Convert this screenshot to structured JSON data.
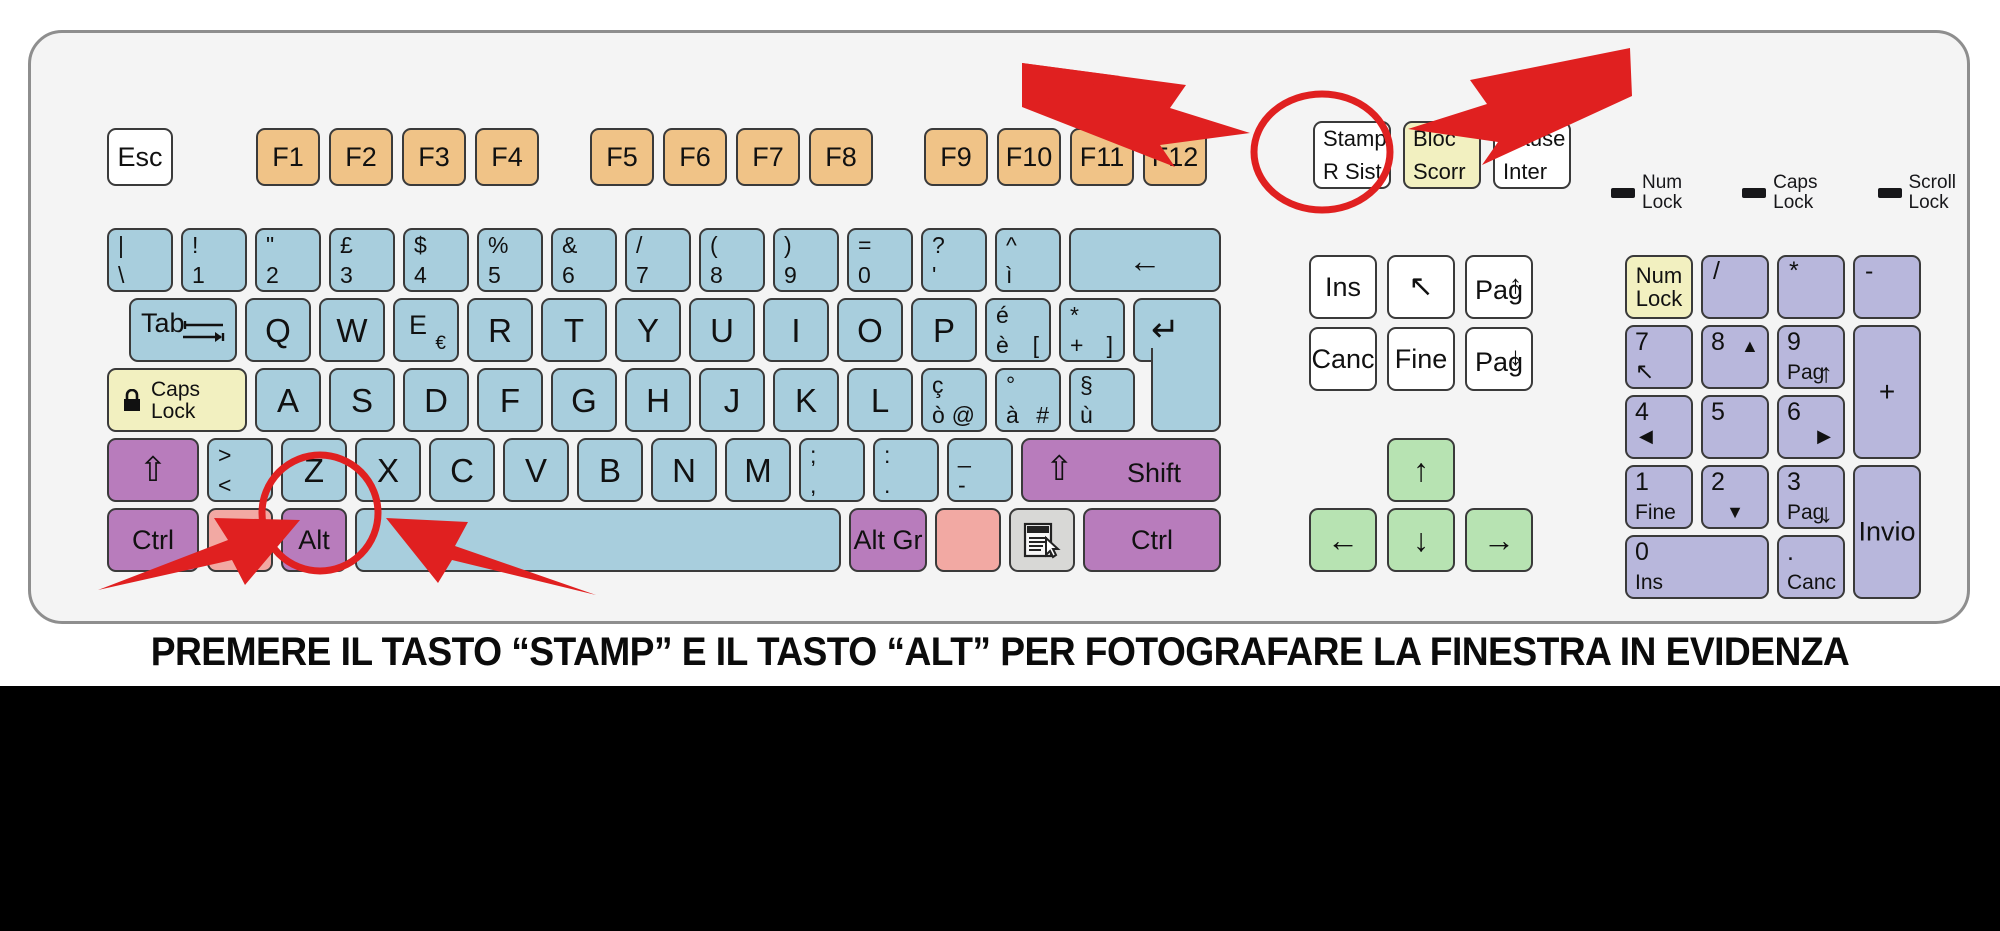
{
  "caption": "PREMERE IL TASTO “STAMP” E IL TASTO “ALT” PER FOTOGRAFARE LA FINESTRA IN EVIDENZA",
  "layout_name": "Italian QWERTY keyboard",
  "colors": {
    "alpha_key": "#a8cedd",
    "function_key": "#f0c387",
    "modifier_key": "#b87cbc",
    "numpad_key": "#b8b7dc",
    "lock_key": "#f2f0c0",
    "arrow_key": "#b7e3b2",
    "win_key": "#f2a9a3",
    "menu_key": "#d8d8d6",
    "highlight": "#e02020",
    "board": "#f4f4f4"
  },
  "escape": {
    "label": "Esc"
  },
  "function_keys": [
    {
      "label": "F1"
    },
    {
      "label": "F2"
    },
    {
      "label": "F3"
    },
    {
      "label": "F4"
    },
    {
      "label": "F5"
    },
    {
      "label": "F6"
    },
    {
      "label": "F7"
    },
    {
      "label": "F8"
    },
    {
      "label": "F9"
    },
    {
      "label": "F10"
    },
    {
      "label": "F11"
    },
    {
      "label": "F12"
    }
  ],
  "system_keys": [
    {
      "top": "Stamp",
      "bottom": "R Sist"
    },
    {
      "top": "Bloc",
      "bottom": "Scorr"
    },
    {
      "top": "Pause",
      "bottom": "Inter"
    }
  ],
  "leds": [
    {
      "line1": "Num",
      "line2": "Lock"
    },
    {
      "line1": "Caps",
      "line2": "Lock"
    },
    {
      "line1": "Scroll",
      "line2": "Lock"
    }
  ],
  "number_row": [
    {
      "top": "|",
      "bottom": "\\"
    },
    {
      "top": "!",
      "bottom": "1"
    },
    {
      "top": "\"",
      "bottom": "2"
    },
    {
      "top": "£",
      "bottom": "3"
    },
    {
      "top": "$",
      "bottom": "4"
    },
    {
      "top": "%",
      "bottom": "5"
    },
    {
      "top": "&",
      "bottom": "6"
    },
    {
      "top": "/",
      "bottom": "7"
    },
    {
      "top": "(",
      "bottom": "8"
    },
    {
      "top": ")",
      "bottom": "9"
    },
    {
      "top": "=",
      "bottom": "0"
    },
    {
      "top": "?",
      "bottom": "'"
    },
    {
      "top": "^",
      "bottom": "ì"
    }
  ],
  "backspace": {
    "glyph": "←"
  },
  "tab": {
    "label": "Tab"
  },
  "qwerty_row": [
    {
      "label": "Q"
    },
    {
      "label": "W"
    },
    {
      "label": "E",
      "sub": "€"
    },
    {
      "label": "R"
    },
    {
      "label": "T"
    },
    {
      "label": "Y"
    },
    {
      "label": "U"
    },
    {
      "label": "I"
    },
    {
      "label": "O"
    },
    {
      "label": "P"
    }
  ],
  "qwerty_extra": [
    {
      "top": "é",
      "bottom": "è",
      "alt": "["
    },
    {
      "top": "*",
      "bottom": "+",
      "alt": "]"
    }
  ],
  "enter": {
    "glyph": "↵"
  },
  "caps_lock": {
    "line1": "Caps",
    "line2": "Lock",
    "icon": "lock-icon"
  },
  "home_row": [
    {
      "label": "A"
    },
    {
      "label": "S"
    },
    {
      "label": "D"
    },
    {
      "label": "F"
    },
    {
      "label": "G"
    },
    {
      "label": "H"
    },
    {
      "label": "J"
    },
    {
      "label": "K"
    },
    {
      "label": "L"
    }
  ],
  "home_extra": [
    {
      "top": "ç",
      "bottom": "ò",
      "alt": "@"
    },
    {
      "top": "°",
      "bottom": "à",
      "alt": "#"
    },
    {
      "top": "§",
      "bottom": "ù",
      "alt": ""
    }
  ],
  "shift_left": {
    "glyph": "⇧"
  },
  "shift_right": {
    "glyph": "⇧",
    "label": "Shift"
  },
  "less_greater": {
    "top": ">",
    "bottom": "<"
  },
  "bottom_alpha_row": [
    {
      "label": "Z"
    },
    {
      "label": "X"
    },
    {
      "label": "C"
    },
    {
      "label": "V"
    },
    {
      "label": "B"
    },
    {
      "label": "N"
    },
    {
      "label": "M"
    }
  ],
  "bottom_extra": [
    {
      "top": ";",
      "bottom": ","
    },
    {
      "top": ":",
      "bottom": "."
    },
    {
      "top": "_",
      "bottom": "-"
    }
  ],
  "modifier_row": {
    "ctrl_left": "Ctrl",
    "win_left": "",
    "alt": "Alt",
    "space": "",
    "alt_gr": "Alt Gr",
    "win_right": "",
    "menu": "menu-icon",
    "ctrl_right": "Ctrl"
  },
  "nav_cluster": [
    {
      "label": "Ins"
    },
    {
      "label": "↖",
      "name": "home-arrow"
    },
    {
      "label": "Pag",
      "arrow": "↑"
    },
    {
      "label": "Canc"
    },
    {
      "label": "Fine"
    },
    {
      "label": "Pag",
      "arrow": "↓"
    }
  ],
  "arrow_keys": {
    "up": "↑",
    "left": "←",
    "down": "↓",
    "right": "→"
  },
  "numpad": {
    "num_lock": {
      "line1": "Num",
      "line2": "Lock"
    },
    "divide": "/",
    "multiply": "*",
    "minus": "-",
    "plus": "+",
    "enter": "Invio",
    "k7": {
      "digit": "7",
      "fn": "↖"
    },
    "k8": {
      "digit": "8",
      "fn": "▲"
    },
    "k9": {
      "digit": "9",
      "fn": "Pag",
      "arrow": "↑"
    },
    "k4": {
      "digit": "4",
      "fn": "◀"
    },
    "k5": {
      "digit": "5",
      "fn": ""
    },
    "k6": {
      "digit": "6",
      "fn": "▶"
    },
    "k1": {
      "digit": "1",
      "fn": "Fine"
    },
    "k2": {
      "digit": "2",
      "fn": "▼"
    },
    "k3": {
      "digit": "3",
      "fn": "Pag",
      "arrow": "↓"
    },
    "k0": {
      "digit": "0",
      "fn": "Ins"
    },
    "kdot": {
      "digit": ".",
      "fn": "Canc"
    }
  },
  "annotations": {
    "circle_stamp": "highlight-circle-stamp",
    "circle_alt": "highlight-circle-alt",
    "arrow_to_stamp": "red-arrow-stamp",
    "arrow_to_blocscorr": "red-arrow-bloc-scorr",
    "arrow_to_ctrl": "red-arrow-ctrl",
    "arrow_to_alt": "red-arrow-alt"
  }
}
